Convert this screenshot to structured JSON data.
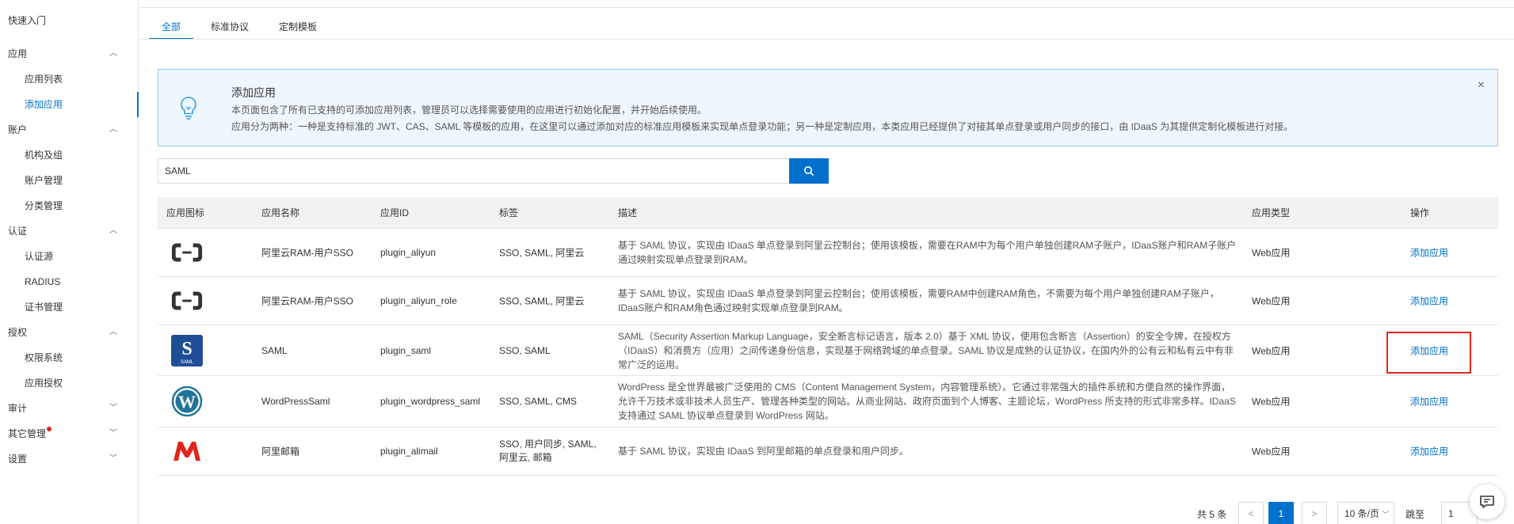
{
  "sidebar": {
    "top_item": "快速入门",
    "groups": [
      {
        "label": "应用",
        "chevron": "up",
        "items": [
          "应用列表",
          "添加应用"
        ]
      },
      {
        "label": "账户",
        "chevron": "up",
        "items": [
          "机构及组",
          "账户管理",
          "分类管理"
        ]
      },
      {
        "label": "认证",
        "chevron": "up",
        "items": [
          "认证源",
          "RADIUS",
          "证书管理"
        ]
      },
      {
        "label": "授权",
        "chevron": "up",
        "items": [
          "权限系统",
          "应用授权"
        ]
      },
      {
        "label": "审计",
        "chevron": "down",
        "items": []
      },
      {
        "label": "其它管理",
        "chevron": "down",
        "items": []
      },
      {
        "label": "设置",
        "chevron": "down",
        "items": []
      }
    ],
    "active_item": "添加应用"
  },
  "tabs": [
    "全部",
    "标准协议",
    "定制模板"
  ],
  "notice": {
    "title": "添加应用",
    "line1": "本页面包含了所有已支持的可添加应用列表，管理员可以选择需要使用的应用进行初始化配置，并开始后续使用。",
    "line2": "应用分为两种：一种是支持标准的 JWT、CAS、SAML 等模板的应用，在这里可以通过添加对应的标准应用模板来实现单点登录功能；另一种是定制应用，本类应用已经提供了对接其单点登录或用户同步的接口，由 IDaaS 为其提供定制化模板进行对接。",
    "close": "×"
  },
  "search": {
    "value": "SAML",
    "icon": "search-icon"
  },
  "table": {
    "headers": [
      "应用图标",
      "应用名称",
      "应用ID",
      "标签",
      "描述",
      "应用类型",
      "操作"
    ],
    "rows": [
      {
        "icon": "aliyun-logo-icon",
        "name": "阿里云RAM-用户SSO",
        "id": "plugin_aliyun",
        "tags": "SSO, SAML, 阿里云",
        "desc": "基于 SAML 协议，实现由 IDaaS 单点登录到阿里云控制台；使用该模板，需要在RAM中为每个用户单独创建RAM子账户，IDaaS账户和RAM子账户通过映射实现单点登录到RAM。",
        "type": "Web应用",
        "action": "添加应用"
      },
      {
        "icon": "aliyun-logo-icon",
        "name": "阿里云RAM-用户SSO",
        "id": "plugin_aliyun_role",
        "tags": "SSO, SAML, 阿里云",
        "desc": "基于 SAML 协议，实现由 IDaaS 单点登录到阿里云控制台；使用该模板，需要RAM中创建RAM角色，不需要为每个用户单独创建RAM子账户，IDaaS账户和RAM角色通过映射实现单点登录到RAM。",
        "type": "Web应用",
        "action": "添加应用"
      },
      {
        "icon": "saml-logo-icon",
        "name": "SAML",
        "id": "plugin_saml",
        "tags": "SSO, SAML",
        "desc": "SAML（Security Assertion Markup Language，安全断言标记语言，版本 2.0）基于 XML 协议，使用包含断言（Assertion）的安全令牌，在授权方（IDaaS）和消费方（应用）之间传递身份信息，实现基于网络跨域的单点登录。SAML 协议是成熟的认证协议，在国内外的公有云和私有云中有非常广泛的运用。",
        "type": "Web应用",
        "action": "添加应用"
      },
      {
        "icon": "wordpress-logo-icon",
        "name": "WordPressSaml",
        "id": "plugin_wordpress_saml",
        "tags": "SSO, SAML, CMS",
        "desc": "WordPress 是全世界最被广泛使用的 CMS（Content Management System，内容管理系统）。它通过非常强大的插件系统和方便自然的操作界面，允许千万技术或非技术人员生产、管理各种类型的网站。从商业网站、政府页面到个人博客、主题论坛，WordPress 所支持的形式非常多样。IDaaS 支持通过 SAML 协议单点登录到 WordPress 网站。",
        "type": "Web应用",
        "action": "添加应用"
      },
      {
        "icon": "alimail-logo-icon",
        "name": "阿里邮箱",
        "id": "plugin_alimail",
        "tags": "SSO, 用户同步, SAML, 阿里云, 邮箱",
        "desc": "基于 SAML 协议，实现由 IDaaS 到阿里邮箱的单点登录和用户同步。",
        "type": "Web应用",
        "action": "添加应用"
      }
    ]
  },
  "pagination": {
    "total": "共 5 条",
    "prev": "<",
    "current": "1",
    "next": ">",
    "page_size": "10 条/页",
    "jump_label": "跳至",
    "jump_value": "1"
  },
  "colors": {
    "accent": "#0070cc",
    "highlight_box": "#e0261c",
    "aliyun": "#333333",
    "saml": "#1f4e96",
    "wordpress": "#21759b",
    "alimail": "#e0261c"
  }
}
